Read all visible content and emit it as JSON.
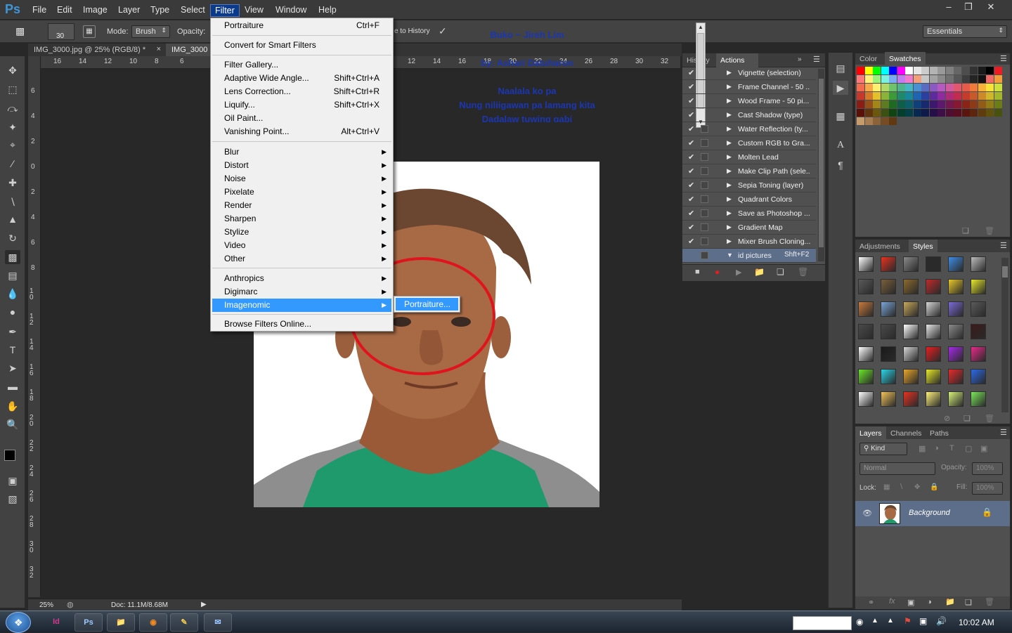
{
  "menubar": {
    "logo": "Ps",
    "items": [
      "File",
      "Edit",
      "Image",
      "Layer",
      "Type",
      "Select",
      "Filter",
      "View",
      "Window",
      "Help"
    ],
    "active": "Filter"
  },
  "options": {
    "brush_size": "30",
    "mode_label": "Mode:",
    "mode_value": "Brush",
    "opacity_label": "Opacity:",
    "history_text": "e to History",
    "workspace": "Essentials"
  },
  "tabs": [
    {
      "label": "IMG_3000.jpg @ 25% (RGB/8) *",
      "close": "×"
    },
    {
      "label": "IMG_3000"
    }
  ],
  "ruler": {
    "h_ticks": [
      "16",
      "14",
      "12",
      "10",
      "8",
      "6",
      "12",
      "14",
      "16",
      "18",
      "20",
      "22",
      "24",
      "26",
      "28",
      "30",
      "32"
    ],
    "v_ticks": [
      "6",
      "4",
      "2",
      "0",
      "2",
      "4",
      "6",
      "8",
      "1 0",
      "1 2",
      "1 4",
      "1 6",
      "1 8",
      "2 0",
      "2 2",
      "2 4",
      "2 6",
      "2 8",
      "3 0",
      "3 2"
    ]
  },
  "overlay": {
    "line1": "Buko ~ Jireh Lim",
    "line2": "by: Ashari Datuharon",
    "line3": "Naalala ko pa",
    "line4": "Nung niliigawan pa lamang kita",
    "line5": "Dadalaw tuwing gabi"
  },
  "status": {
    "zoom": "25%",
    "doc": "Doc: 11.1M/8.68M"
  },
  "filter_menu": {
    "items": [
      {
        "label": "Portraiture",
        "shortcut": "Ctrl+F"
      },
      {
        "label": "Convert for Smart Filters"
      },
      {
        "label": "Filter Gallery..."
      },
      {
        "label": "Adaptive Wide Angle...",
        "shortcut": "Shift+Ctrl+A"
      },
      {
        "label": "Lens Correction...",
        "shortcut": "Shift+Ctrl+R"
      },
      {
        "label": "Liquify...",
        "shortcut": "Shift+Ctrl+X"
      },
      {
        "label": "Oil Paint..."
      },
      {
        "label": "Vanishing Point...",
        "shortcut": "Alt+Ctrl+V"
      },
      {
        "label": "Blur"
      },
      {
        "label": "Distort"
      },
      {
        "label": "Noise"
      },
      {
        "label": "Pixelate"
      },
      {
        "label": "Render"
      },
      {
        "label": "Sharpen"
      },
      {
        "label": "Stylize"
      },
      {
        "label": "Video"
      },
      {
        "label": "Other"
      },
      {
        "label": "Anthropics"
      },
      {
        "label": "Digimarc"
      },
      {
        "label": "Imagenomic"
      },
      {
        "label": "Browse Filters Online..."
      }
    ],
    "submenu_item": "Portraiture..."
  },
  "actions_panel": {
    "tab_history": "History",
    "tab_actions": "Actions",
    "rows": [
      "Vignette (selection)",
      "Frame Channel - 50 ...",
      "Wood Frame - 50 pi...",
      "Cast Shadow (type)",
      "Water Reflection (ty...",
      "Custom RGB to Gra...",
      "Molten Lead",
      "Make Clip Path (sele...",
      "Sepia Toning (layer)",
      "Quadrant Colors",
      "Save as Photoshop ...",
      "Gradient Map",
      "Mixer Brush Cloning..."
    ],
    "selected_row": "id pictures",
    "selected_shortcut": "Shft+F2"
  },
  "right_panels": {
    "color_tab": "Color",
    "swatches_tab": "Swatches",
    "adjustments_tab": "Adjustments",
    "styles_tab": "Styles",
    "layers_tab": "Layers",
    "channels_tab": "Channels",
    "paths_tab": "Paths",
    "kind_label": "Kind",
    "blend_mode": "Normal",
    "opacity_label": "Opacity:",
    "opacity_value": "100%",
    "lock_label": "Lock:",
    "fill_label": "Fill:",
    "fill_value": "100%",
    "layer_name": "Background"
  },
  "taskbar": {
    "apps": [
      "Id",
      "Ps",
      "",
      "",
      "",
      ""
    ],
    "clock": "10:02 AM"
  },
  "colors": {
    "accent": "#3399ff",
    "menu_bg": "#f0f0f0",
    "annotation": "#e0141c",
    "overlay_text": "#1b36b3"
  }
}
